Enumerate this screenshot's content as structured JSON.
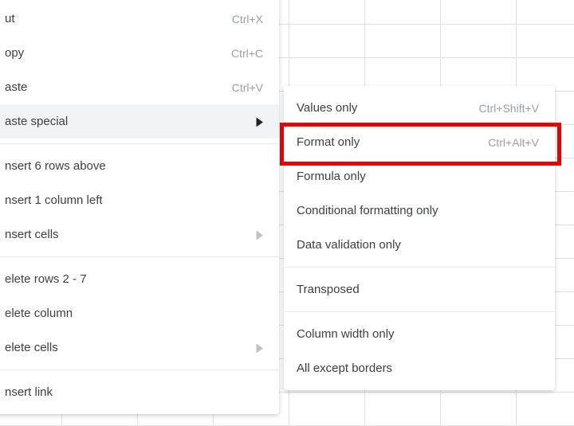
{
  "main_menu": {
    "cut": {
      "label": "ut",
      "shortcut": "Ctrl+X"
    },
    "copy": {
      "label": "opy",
      "shortcut": "Ctrl+C"
    },
    "paste": {
      "label": "aste",
      "shortcut": "Ctrl+V"
    },
    "paste_special": {
      "label": "aste special"
    },
    "insert_rows": {
      "label": "nsert 6 rows above"
    },
    "insert_col": {
      "label": "nsert 1 column left"
    },
    "insert_cells": {
      "label": "nsert cells"
    },
    "delete_rows": {
      "label": "elete rows 2 - 7"
    },
    "delete_col": {
      "label": "elete column"
    },
    "delete_cells": {
      "label": "elete cells"
    },
    "insert_link": {
      "label": "nsert link"
    }
  },
  "sub_menu": {
    "values_only": {
      "label": "Values only",
      "shortcut": "Ctrl+Shift+V"
    },
    "format_only": {
      "label": "Format only",
      "shortcut": "Ctrl+Alt+V"
    },
    "formula_only": {
      "label": "Formula only"
    },
    "cond_fmt": {
      "label": "Conditional formatting only"
    },
    "data_val": {
      "label": "Data validation only"
    },
    "transposed": {
      "label": "Transposed"
    },
    "col_width": {
      "label": "Column width only"
    },
    "all_except": {
      "label": "All except borders"
    }
  },
  "highlight": {
    "target": "format_only"
  }
}
